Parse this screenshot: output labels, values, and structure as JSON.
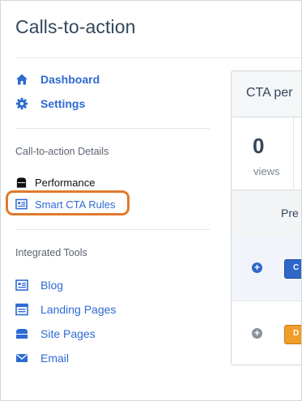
{
  "page": {
    "title": "Calls-to-action"
  },
  "nav": {
    "dashboard": "Dashboard",
    "settings": "Settings"
  },
  "cta_details": {
    "title": "Call-to-action Details",
    "items": [
      {
        "label": "Performance",
        "icon": "performance-icon"
      },
      {
        "label": "Smart CTA Rules",
        "icon": "rules-icon"
      }
    ]
  },
  "integrated_tools": {
    "title": "Integrated Tools",
    "items": [
      {
        "label": "Blog",
        "icon": "blog-icon"
      },
      {
        "label": "Landing Pages",
        "icon": "landing-pages-icon"
      },
      {
        "label": "Site Pages",
        "icon": "site-pages-icon"
      },
      {
        "label": "Email",
        "icon": "email-icon"
      }
    ]
  },
  "panel": {
    "title": "CTA per",
    "stat_value": "0",
    "stat_label": "views",
    "column_header": "Pre",
    "row1_button": "C",
    "row2_button": "D"
  },
  "colors": {
    "link": "#2e6ad1",
    "highlight": "#e07b2e",
    "title_text": "#33475b"
  }
}
